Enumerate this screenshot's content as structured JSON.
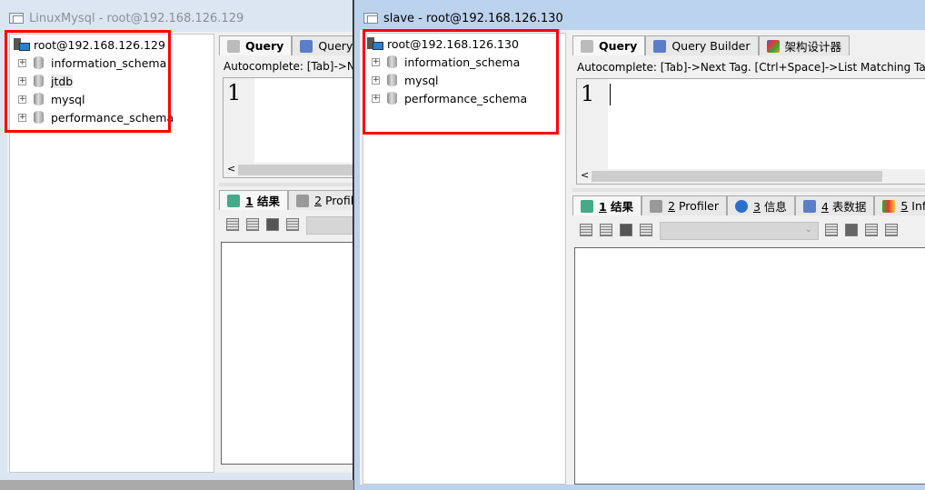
{
  "left_window": {
    "title": "LinuxMysql - root@192.168.126.129",
    "tree": {
      "root": "root@192.168.126.129",
      "databases": [
        "information_schema",
        "jtdb",
        "mysql",
        "performance_schema"
      ]
    },
    "editor_tabs": [
      "Query",
      "Query Bu"
    ],
    "autocomplete_hint": "Autocomplete: [Tab]->Ne",
    "line_number": "1",
    "result_tabs": [
      {
        "num": "1",
        "label": " 结果"
      },
      {
        "num": "2",
        "label": " Profil"
      }
    ]
  },
  "right_window": {
    "title": "slave - root@192.168.126.130",
    "tree": {
      "root": "root@192.168.126.130",
      "databases": [
        "information_schema",
        "mysql",
        "performance_schema"
      ]
    },
    "editor_tabs": [
      "Query",
      "Query Builder",
      "架构设计器"
    ],
    "autocomplete_hint": "Autocomplete: [Tab]->Next Tag. [Ctrl+Space]->List Matching Tags.",
    "line_number": "1",
    "result_tabs": [
      {
        "num": "1",
        "label": " 结果"
      },
      {
        "num": "2",
        "label": " Profiler"
      },
      {
        "num": "3",
        "label": " 信息"
      },
      {
        "num": "4",
        "label": " 表数据"
      },
      {
        "num": "5",
        "label": " Inf"
      }
    ]
  },
  "colors": {
    "highlight_box": "#ff0000",
    "active_frame": "#bcd3ee",
    "inactive_frame": "#dbe6f2"
  }
}
